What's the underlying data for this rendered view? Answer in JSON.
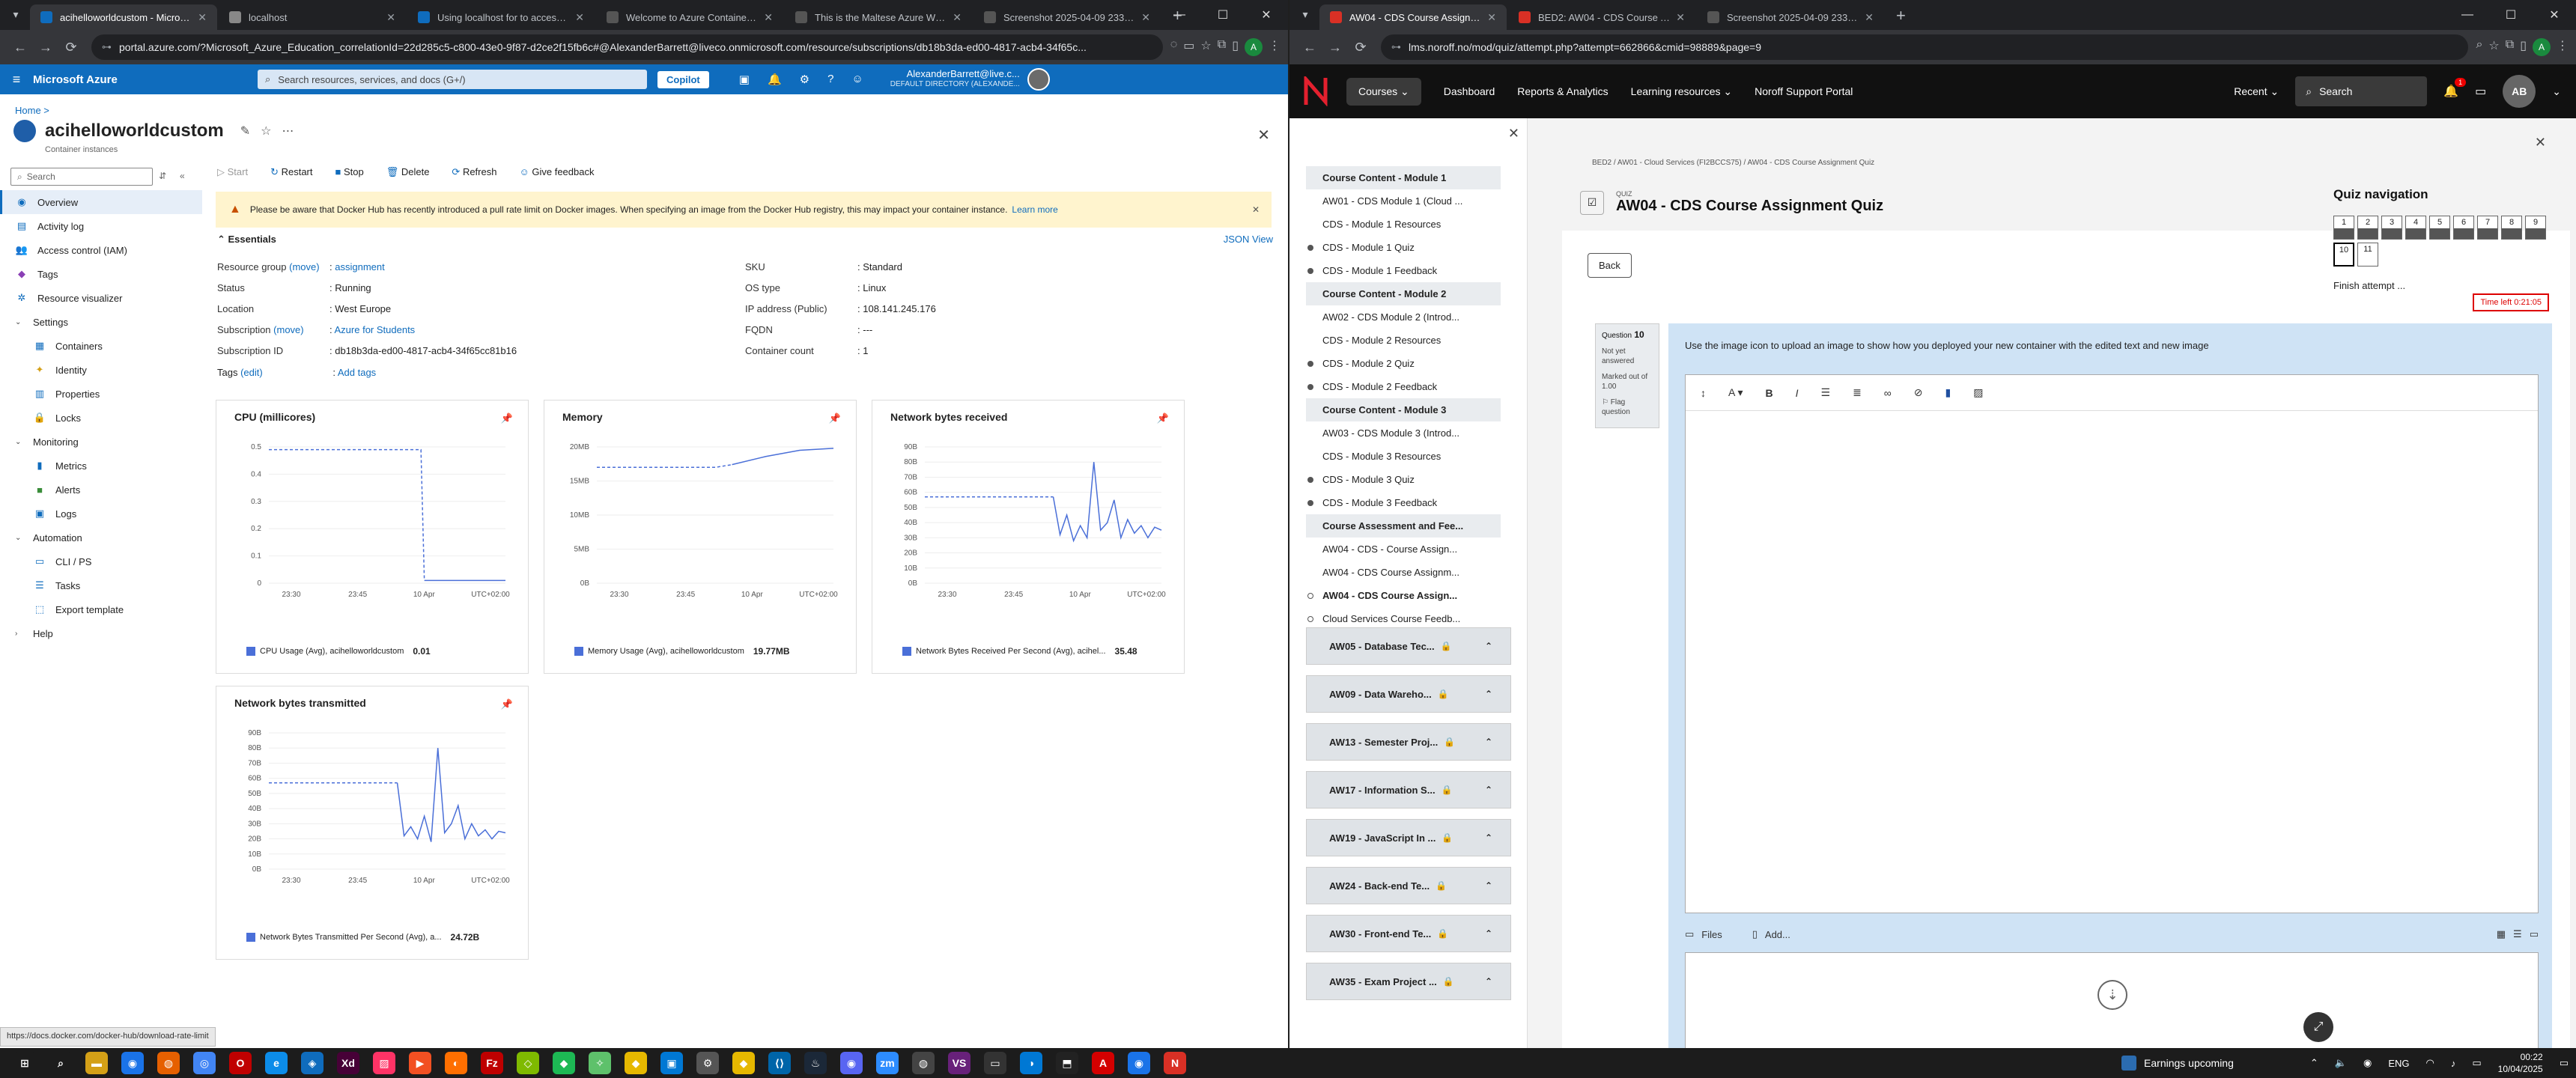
{
  "left": {
    "tabs": [
      {
        "title": "acihelloworldcustom - Micros...",
        "active": true,
        "color": "#0f6cbd"
      },
      {
        "title": "localhost",
        "active": false,
        "color": "#888888"
      },
      {
        "title": "Using localhost for to access r...",
        "active": false,
        "color": "#0f6cbd"
      },
      {
        "title": "Welcome to Azure Container In...",
        "active": false,
        "color": "#555555"
      },
      {
        "title": "This is the Maltese Azure Wind...",
        "active": false,
        "color": "#555555"
      },
      {
        "title": "Screenshot 2025-04-09 23322...",
        "active": false,
        "color": "#555555"
      }
    ],
    "url": "portal.azure.com/?Microsoft_Azure_Education_correlationId=22d285c5-c800-43e0-9f87-d2ce2f15fb6c#@AlexanderBarrett@liveco.onmicrosoft.com/resource/subscriptions/db18b3da-ed00-4817-acb4-34f65c...",
    "brand": "Microsoft Azure",
    "search_placeholder": "Search resources, services, and docs (G+/)",
    "copilot": "Copilot",
    "user_name": "AlexanderBarrett@live.c...",
    "user_dir": "DEFAULT DIRECTORY (ALEXANDE...",
    "breadcrumb": "Home  >",
    "resource_title": "acihelloworldcustom",
    "resource_sub": "Container instances",
    "nav_search": "Search",
    "nav": [
      {
        "label": "Overview",
        "icon": "◉",
        "type": "item",
        "active": true,
        "color": "#0f6cbd"
      },
      {
        "label": "Activity log",
        "icon": "▤",
        "type": "item",
        "color": "#0f6cbd"
      },
      {
        "label": "Access control (IAM)",
        "icon": "👥",
        "type": "item",
        "color": "#0f6cbd"
      },
      {
        "label": "Tags",
        "icon": "◆",
        "type": "item",
        "color": "#8a3fb5"
      },
      {
        "label": "Resource visualizer",
        "icon": "✲",
        "type": "item",
        "color": "#0f6cbd"
      },
      {
        "label": "Settings",
        "type": "group"
      },
      {
        "label": "Containers",
        "icon": "▦",
        "type": "sub",
        "color": "#0f6cbd"
      },
      {
        "label": "Identity",
        "icon": "✦",
        "type": "sub",
        "color": "#d4a017"
      },
      {
        "label": "Properties",
        "icon": "▥",
        "type": "sub",
        "color": "#0f6cbd"
      },
      {
        "label": "Locks",
        "icon": "🔒",
        "type": "sub",
        "color": "#0f6cbd"
      },
      {
        "label": "Monitoring",
        "type": "group"
      },
      {
        "label": "Metrics",
        "icon": "▮",
        "type": "sub",
        "color": "#0f6cbd"
      },
      {
        "label": "Alerts",
        "icon": "■",
        "type": "sub",
        "color": "#3a8d3a"
      },
      {
        "label": "Logs",
        "icon": "▣",
        "type": "sub",
        "color": "#0f6cbd"
      },
      {
        "label": "Automation",
        "type": "group"
      },
      {
        "label": "CLI / PS",
        "icon": "▭",
        "type": "sub",
        "color": "#0f6cbd"
      },
      {
        "label": "Tasks",
        "icon": "☰",
        "type": "sub",
        "color": "#0f6cbd"
      },
      {
        "label": "Export template",
        "icon": "⬚",
        "type": "sub",
        "color": "#0f6cbd"
      },
      {
        "label": "Help",
        "type": "group-collapsed"
      }
    ],
    "commands": [
      "Start",
      "Restart",
      "Stop",
      "Delete",
      "Refresh",
      "Give feedback"
    ],
    "banner_text": "Please be aware that Docker Hub has recently introduced a pull rate limit on Docker images. When specifying an image from the Docker Hub registry, this may impact your container instance.",
    "banner_link": "Learn more",
    "essentials_label": "Essentials",
    "json_view": "JSON View",
    "essentials_left": [
      {
        "k": "Resource group",
        "move": "(move)",
        "v": "assignment",
        "link": true
      },
      {
        "k": "Status",
        "v": "Running"
      },
      {
        "k": "Location",
        "v": "West Europe"
      },
      {
        "k": "Subscription",
        "move": "(move)",
        "v": "Azure for Students",
        "link": true
      },
      {
        "k": "Subscription ID",
        "v": "db18b3da-ed00-4817-acb4-34f65cc81b16"
      }
    ],
    "essentials_right": [
      {
        "k": "SKU",
        "v": "Standard"
      },
      {
        "k": "OS type",
        "v": "Linux"
      },
      {
        "k": "IP address (Public)",
        "v": "108.141.245.176"
      },
      {
        "k": "FQDN",
        "v": "---"
      },
      {
        "k": "Container count",
        "v": "1"
      }
    ],
    "tags_label": "Tags",
    "tags_edit": "(edit)",
    "tags_add": "Add tags",
    "status_url": "https://docs.docker.com/docker-hub/download-rate-limit"
  },
  "chart_data": [
    {
      "type": "line",
      "title": "CPU (millicores)",
      "yticks": [
        "0.5",
        "0.4",
        "0.3",
        "0.2",
        "0.1",
        "0"
      ],
      "ylim": [
        0,
        0.5
      ],
      "xticks": [
        "23:30",
        "23:45",
        "10 Apr",
        "UTC+02:00"
      ],
      "x": [
        0,
        10,
        20,
        30,
        40,
        45,
        46,
        55,
        65,
        70
      ],
      "y": [
        0.49,
        0.49,
        0.49,
        0.49,
        0.49,
        0.49,
        0.01,
        0.01,
        0.01,
        0.01
      ],
      "dashed_until": 6,
      "legend": "CPU Usage (Avg), acihelloworldcustom",
      "legend_value": "0.01"
    },
    {
      "type": "line",
      "title": "Memory",
      "yticks": [
        "20MB",
        "15MB",
        "10MB",
        "5MB",
        "0B"
      ],
      "ylim": [
        0,
        20
      ],
      "xticks": [
        "23:30",
        "23:45",
        "10 Apr",
        "UTC+02:00"
      ],
      "x": [
        0,
        10,
        20,
        30,
        35,
        40,
        50,
        60,
        70
      ],
      "y": [
        17,
        17,
        17,
        17,
        17,
        17.4,
        18.6,
        19.5,
        19.8
      ],
      "dashed_until": 5,
      "legend": "Memory Usage (Avg), acihelloworldcustom",
      "legend_value": "19.77MB"
    },
    {
      "type": "line",
      "title": "Network bytes received",
      "yticks": [
        "90B",
        "80B",
        "70B",
        "60B",
        "50B",
        "40B",
        "30B",
        "20B",
        "10B",
        "0B"
      ],
      "ylim": [
        0,
        90
      ],
      "xticks": [
        "23:30",
        "23:45",
        "10 Apr",
        "UTC+02:00"
      ],
      "x": [
        0,
        10,
        20,
        30,
        38,
        40,
        42,
        44,
        46,
        48,
        50,
        52,
        54,
        56,
        58,
        60,
        62,
        64,
        66,
        68,
        70
      ],
      "y": [
        57,
        57,
        57,
        57,
        57,
        32,
        45,
        28,
        38,
        30,
        80,
        35,
        40,
        55,
        30,
        42,
        33,
        38,
        30,
        37,
        35
      ],
      "dashed_until": 4,
      "legend": "Network Bytes Received Per Second (Avg), acihel...",
      "legend_value": "35.48"
    },
    {
      "type": "line",
      "title": "Network bytes transmitted",
      "yticks": [
        "90B",
        "80B",
        "70B",
        "60B",
        "50B",
        "40B",
        "30B",
        "20B",
        "10B",
        "0B"
      ],
      "ylim": [
        0,
        90
      ],
      "xticks": [
        "23:30",
        "23:45",
        "10 Apr",
        "UTC+02:00"
      ],
      "x": [
        0,
        10,
        20,
        30,
        38,
        40,
        42,
        44,
        46,
        48,
        50,
        52,
        54,
        56,
        58,
        60,
        62,
        64,
        66,
        68,
        70
      ],
      "y": [
        57,
        57,
        57,
        57,
        57,
        22,
        28,
        20,
        35,
        18,
        80,
        24,
        30,
        42,
        20,
        30,
        22,
        26,
        20,
        25,
        24
      ],
      "dashed_until": 4,
      "legend": "Network Bytes Transmitted Per Second (Avg), a...",
      "legend_value": "24.72B"
    }
  ],
  "right": {
    "tabs": [
      {
        "title": "AW04 - CDS Course Assignme...",
        "active": true,
        "color": "#d93025"
      },
      {
        "title": "BED2: AW04 - CDS Course Ass...",
        "active": false,
        "color": "#d93025"
      },
      {
        "title": "Screenshot 2025-04-09 23322...",
        "active": false,
        "color": "#555555"
      }
    ],
    "url": "lms.noroff.no/mod/quiz/attempt.php?attempt=662866&cmid=98889&page=9",
    "nav": [
      "Courses",
      "Dashboard",
      "Reports & Analytics",
      "Learning resources",
      "Noroff Support Portal"
    ],
    "recent": "Recent",
    "search": "Search",
    "notif_count": "1",
    "avatar": "AB",
    "drawer_items": [
      {
        "label": "Course Content - Module 1",
        "type": "section"
      },
      {
        "label": "AW01 - CDS Module 1 (Cloud ...",
        "type": "item"
      },
      {
        "label": "CDS - Module 1 Resources",
        "type": "item"
      },
      {
        "label": "CDS - Module 1 Quiz",
        "type": "dot"
      },
      {
        "label": "CDS - Module 1 Feedback",
        "type": "dot"
      },
      {
        "label": "Course Content - Module 2",
        "type": "section"
      },
      {
        "label": "AW02 - CDS Module 2 (Introd...",
        "type": "item"
      },
      {
        "label": "CDS - Module 2 Resources",
        "type": "item"
      },
      {
        "label": "CDS - Module 2 Quiz",
        "type": "dot"
      },
      {
        "label": "CDS - Module 2 Feedback",
        "type": "dot"
      },
      {
        "label": "Course Content - Module 3",
        "type": "section"
      },
      {
        "label": "AW03 - CDS Module 3 (Introd...",
        "type": "item"
      },
      {
        "label": "CDS - Module 3 Resources",
        "type": "item"
      },
      {
        "label": "CDS - Module 3 Quiz",
        "type": "dot"
      },
      {
        "label": "CDS - Module 3 Feedback",
        "type": "dot"
      },
      {
        "label": "Course Assessment  and Fee...",
        "type": "section"
      },
      {
        "label": "AW04 - CDS - Course Assign...",
        "type": "item"
      },
      {
        "label": "AW04 - CDS Course Assignm...",
        "type": "item"
      },
      {
        "label": "AW04 - CDS Course Assign...",
        "type": "ring-current"
      },
      {
        "label": "Cloud Services Course Feedb...",
        "type": "ring"
      }
    ],
    "courses": [
      "AW05 - Database Tec...",
      "AW09 - Data Wareho...",
      "AW13 - Semester Proj...",
      "AW17 - Information S...",
      "AW19 - JavaScript In ...",
      "AW24 - Back-end Te...",
      "AW30 - Front-end Te...",
      "AW35 - Exam Project ..."
    ],
    "breadcrumb": "BED2 / AW01 - Cloud Services (FI2BCCS75) / AW04 - CDS Course Assignment Quiz",
    "quiz_small": "QUIZ",
    "quiz_title": "AW04 - CDS Course Assignment Quiz",
    "back": "Back",
    "timer": "Time left 0:21:05",
    "question_label": "Question",
    "question_num": "10",
    "q_status": "Not yet answered",
    "q_marks": "Marked out of 1.00",
    "q_flag": "Flag question",
    "q_text": "Use the image icon to upload an image to show how you deployed your new container with the edited text and new image",
    "files": "Files",
    "add": "Add...",
    "quiz_nav_title": "Quiz navigation",
    "quiz_nav": [
      {
        "n": "1",
        "state": "answered"
      },
      {
        "n": "2",
        "state": "answered"
      },
      {
        "n": "3",
        "state": "answered"
      },
      {
        "n": "4",
        "state": "answered"
      },
      {
        "n": "5",
        "state": "answered"
      },
      {
        "n": "6",
        "state": "answered"
      },
      {
        "n": "7",
        "state": "answered"
      },
      {
        "n": "8",
        "state": "answered"
      },
      {
        "n": "9",
        "state": "answered"
      },
      {
        "n": "10",
        "state": "current"
      },
      {
        "n": "11",
        "state": "empty"
      }
    ],
    "finish": "Finish attempt ..."
  },
  "taskbar": {
    "apps": [
      {
        "label": "⊞",
        "color": "#1c1c1c"
      },
      {
        "label": "⌕",
        "color": "#1c1c1c"
      },
      {
        "label": "▬",
        "color": "#d4a017"
      },
      {
        "label": "◉",
        "color": "#1a73e8"
      },
      {
        "label": "◍",
        "color": "#e66000"
      },
      {
        "label": "◎",
        "color": "#4285f4"
      },
      {
        "label": "O",
        "color": "#c00000"
      },
      {
        "label": "e",
        "color": "#0c8ce9"
      },
      {
        "label": "◈",
        "color": "#0f6cbd"
      },
      {
        "label": "Xd",
        "color": "#470137"
      },
      {
        "label": "▨",
        "color": "#ff3366"
      },
      {
        "label": "▶",
        "color": "#f25022"
      },
      {
        "label": "◐",
        "color": "#ff6f00"
      },
      {
        "label": "Fz",
        "color": "#bf0000"
      },
      {
        "label": "◇",
        "color": "#7fba00"
      },
      {
        "label": "◆",
        "color": "#1db954"
      },
      {
        "label": "✧",
        "color": "#5ec16b"
      },
      {
        "label": "◆",
        "color": "#e6b800"
      },
      {
        "label": "▣",
        "color": "#0078d4"
      },
      {
        "label": "⚙",
        "color": "#555555"
      },
      {
        "label": "◆",
        "color": "#e6b800"
      },
      {
        "label": "⟨⟩",
        "color": "#0065a9"
      },
      {
        "label": "♨",
        "color": "#1b2838"
      },
      {
        "label": "◉",
        "color": "#5865f2"
      },
      {
        "label": "zm",
        "color": "#2d8cff"
      },
      {
        "label": "◍",
        "color": "#444444"
      },
      {
        "label": "VS",
        "color": "#68217a"
      },
      {
        "label": "▭",
        "color": "#333333"
      },
      {
        "label": "◑",
        "color": "#0078d4"
      },
      {
        "label": "⬒",
        "color": "#222222"
      },
      {
        "label": "A",
        "color": "#d40000"
      },
      {
        "label": "◉",
        "color": "#1a73e8"
      },
      {
        "label": "N",
        "color": "#d93025"
      }
    ],
    "news": "Earnings upcoming",
    "lang": "ENG",
    "time": "00:22",
    "date": "10/04/2025"
  }
}
